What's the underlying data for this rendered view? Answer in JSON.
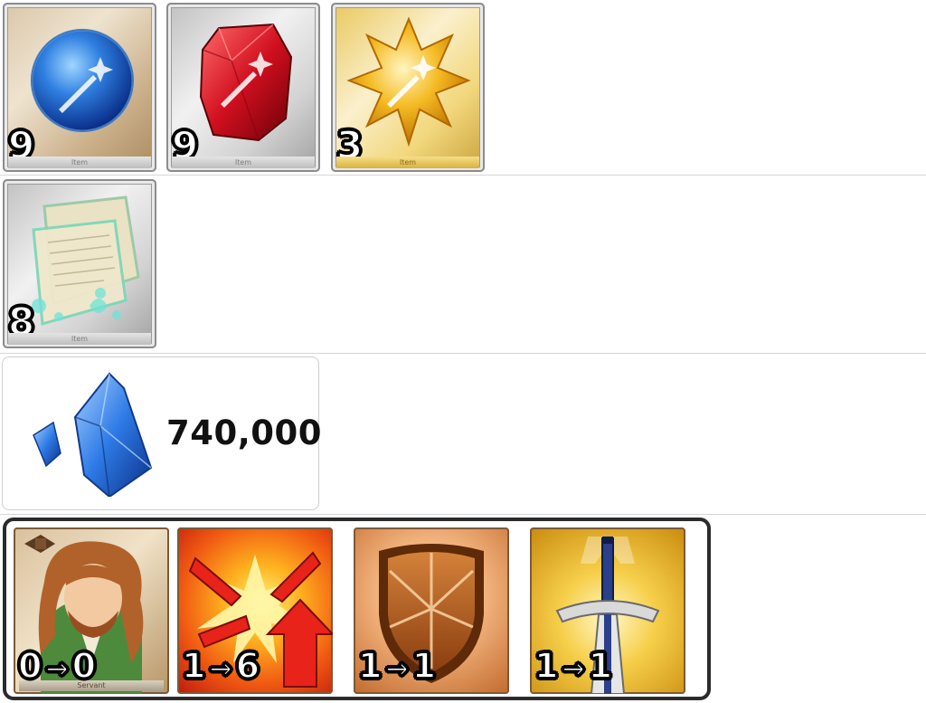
{
  "materials": [
    {
      "name": "blue-orb",
      "count": "9",
      "tag": "Item",
      "frame": "wood"
    },
    {
      "name": "red-gem",
      "count": "9",
      "tag": "Item",
      "frame": "silver"
    },
    {
      "name": "gold-crystal",
      "count": "3",
      "tag": "Item",
      "frame": "gold"
    },
    {
      "name": "scroll",
      "count": "8",
      "tag": "Item",
      "frame": "silver"
    }
  ],
  "qp": {
    "amount": "740,000",
    "icon": "blue-crystal-icon"
  },
  "upgrades": [
    {
      "icon": "servant-portrait",
      "tag": "Servant",
      "from": "0",
      "arrow": "→",
      "to": "0"
    },
    {
      "icon": "skill-burst-icon",
      "from": "1",
      "arrow": "→",
      "to": "6"
    },
    {
      "icon": "skill-shield-icon",
      "from": "1",
      "arrow": "→",
      "to": "1"
    },
    {
      "icon": "skill-sword-icon",
      "from": "1",
      "arrow": "→",
      "to": "1"
    }
  ],
  "colors": {
    "frame_border": "#2b2b2b",
    "divider": "#d6d6d6",
    "count_fill": "#ffffff",
    "count_outline": "#000000"
  }
}
